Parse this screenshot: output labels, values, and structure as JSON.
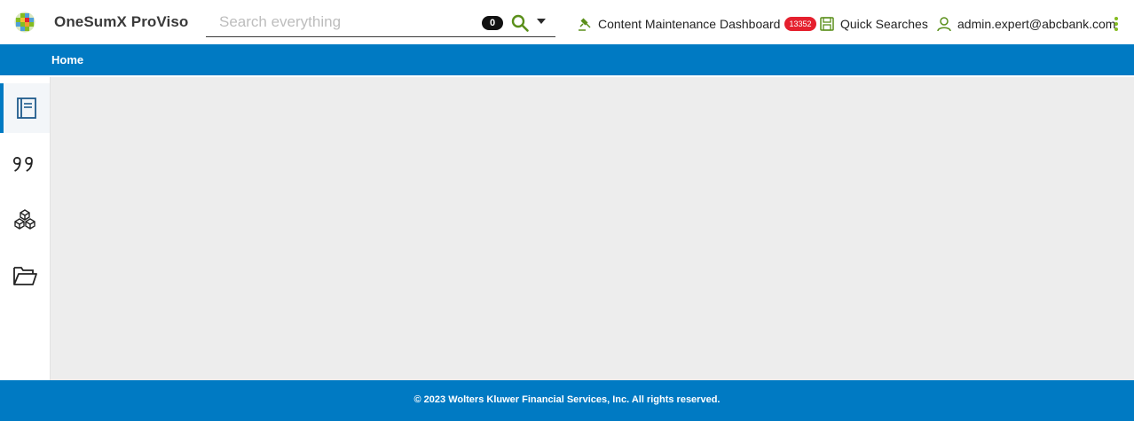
{
  "header": {
    "app_title": "OneSumX ProViso",
    "search": {
      "placeholder": "Search everything",
      "count": "0"
    },
    "links": {
      "dashboard_label": "Content Maintenance Dashboard",
      "dashboard_badge": "13352",
      "quick_searches_label": "Quick Searches",
      "user_label": "admin.expert@abcbank.com"
    },
    "icons": {
      "logo": "wolters-kluwer-logo-icon",
      "search": "search-icon",
      "caret": "caret-down-icon",
      "dashboard": "gavel-icon",
      "quick_searches": "save-disk-icon",
      "user": "user-icon",
      "more": "kebab-menu-icon"
    }
  },
  "breadcrumb": {
    "home_label": "Home"
  },
  "sidebar": {
    "items": [
      {
        "icon": "document-icon",
        "active": true
      },
      {
        "icon": "quote-icon",
        "active": false
      },
      {
        "icon": "cubes-icon",
        "active": false
      },
      {
        "icon": "folder-open-icon",
        "active": false
      }
    ]
  },
  "footer": {
    "copyright": "© 2023 Wolters Kluwer Financial Services, Inc. All rights reserved."
  },
  "colors": {
    "brand_blue": "#007ac3",
    "accent_green": "#85bc20",
    "badge_red": "#e5202e",
    "content_bg": "#ededed"
  }
}
